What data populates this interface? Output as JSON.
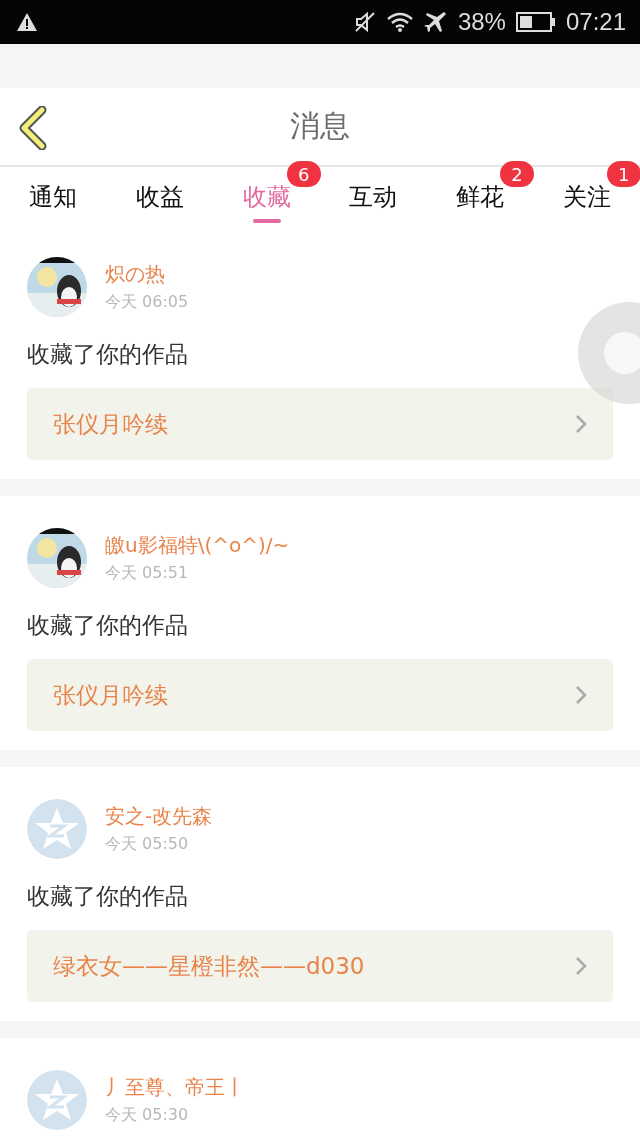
{
  "status_bar": {
    "battery": "38%",
    "time": "07:21"
  },
  "header": {
    "title": "消息"
  },
  "tabs": [
    {
      "label": "通知",
      "selected": false
    },
    {
      "label": "收益",
      "selected": false
    },
    {
      "label": "收藏",
      "selected": true,
      "badge": "6"
    },
    {
      "label": "互动",
      "selected": false
    },
    {
      "label": "鲜花",
      "selected": false,
      "badge": "2"
    },
    {
      "label": "关注",
      "selected": false,
      "badge": "1"
    }
  ],
  "messages": [
    {
      "name": "炽の热",
      "time": "今天 06:05",
      "action": "收藏了你的作品",
      "work": "张仪月吟续"
    },
    {
      "name": "皦u影福特\\(^o^)/~",
      "time": "今天 05:51",
      "action": "收藏了你的作品",
      "work": "张仪月吟续"
    },
    {
      "avatar": {
        "kind": "icon"
      },
      "name": "安之-改先森",
      "time": "今天 05:50",
      "action": "收藏了你的作品",
      "work": "绿衣女——星橙非然——d030"
    },
    {
      "avatar": {
        "kind": "icon"
      },
      "name": "丿至尊、帝王丨",
      "time": "今天 05:30"
    }
  ]
}
